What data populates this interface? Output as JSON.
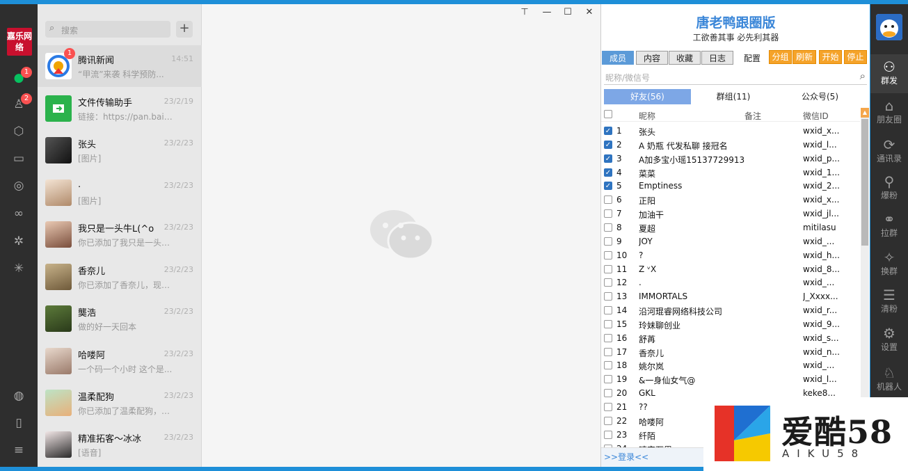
{
  "rail": {
    "logo_text": "嘉乐网络",
    "chat_badge": "1",
    "contacts_badge": "2"
  },
  "chat_list": {
    "search_placeholder": "搜索",
    "add_label": "+",
    "items": [
      {
        "name": "腾讯新闻",
        "time": "14:51",
        "preview": "“甲流”来袭 科学预防...",
        "badge": "1"
      },
      {
        "name": "文件传输助手",
        "time": "23/2/19",
        "preview": "链接：https://pan.baid..."
      },
      {
        "name": "张头",
        "time": "23/2/23",
        "preview": "[图片]"
      },
      {
        "name": ".",
        "time": "23/2/23",
        "preview": "[图片]"
      },
      {
        "name": "我只是一头牛ᒪ(^o",
        "time": "23/2/23",
        "preview": "你已添加了我只是一头牛..."
      },
      {
        "name": "香奈儿",
        "time": "23/2/23",
        "preview": "你已添加了香奈儿，现在..."
      },
      {
        "name": "龑浩",
        "time": "23/2/23",
        "preview": "做的好一天回本"
      },
      {
        "name": "哈喽阿",
        "time": "23/2/23",
        "preview": "一个码一个小时 这个是..."
      },
      {
        "name": "温柔配狗",
        "time": "23/2/23",
        "preview": "你已添加了温柔配狗，现..."
      },
      {
        "name": "精准拓客～冰冰",
        "time": "23/2/23",
        "preview": "[语音]"
      }
    ]
  },
  "window_controls": {
    "pin": "⊤",
    "minimize": "—",
    "maximize": "☐",
    "close": "✕"
  },
  "plugin": {
    "title": "唐老鸭跟圈版",
    "subtitle": "工欲善其事 必先利其器",
    "tabs": [
      "成员",
      "内容",
      "收藏",
      "日志",
      "配置"
    ],
    "buttons": [
      "分组",
      "刷新",
      "开始",
      "停止"
    ],
    "search_placeholder": "昵称/微信号",
    "subtabs": [
      "好友(56)",
      "群组(11)",
      "公众号(5)"
    ],
    "columns": {
      "nickname": "昵称",
      "remark": "备注",
      "wxid": "微信ID"
    },
    "rows": [
      {
        "no": "1",
        "nick": "张头",
        "wxid": "wxid_x...",
        "checked": true
      },
      {
        "no": "2",
        "nick": "A 奶瓶 代发私聊 接冠名",
        "wxid": "wxid_l...",
        "checked": true
      },
      {
        "no": "3",
        "nick": "A加多宝小瑶15137729913",
        "wxid": "wxid_p...",
        "checked": true
      },
      {
        "no": "4",
        "nick": "菜菜",
        "wxid": "wxid_1...",
        "checked": true
      },
      {
        "no": "5",
        "nick": "Emptiness",
        "wxid": "wxid_2...",
        "checked": true
      },
      {
        "no": "6",
        "nick": "正阳",
        "wxid": "wxid_x...",
        "checked": false
      },
      {
        "no": "7",
        "nick": "加油干",
        "wxid": "wxid_jl...",
        "checked": false
      },
      {
        "no": "8",
        "nick": "夏超",
        "wxid": "mitilasu",
        "checked": false
      },
      {
        "no": "9",
        "nick": "JOY",
        "wxid": "wxid_...",
        "checked": false
      },
      {
        "no": "10",
        "nick": "?",
        "wxid": "wxid_h...",
        "checked": false
      },
      {
        "no": "11",
        "nick": "Z ᵛX",
        "wxid": "wxid_8...",
        "checked": false
      },
      {
        "no": "12",
        "nick": ".",
        "wxid": "wxid_...",
        "checked": false
      },
      {
        "no": "13",
        "nick": "IMMORTALS",
        "wxid": "J_Xxxx...",
        "checked": false
      },
      {
        "no": "14",
        "nick": "沿河琨睿网络科技公司",
        "wxid": "wxid_r...",
        "checked": false
      },
      {
        "no": "15",
        "nick": "玲妹聊创业",
        "wxid": "wxid_9...",
        "checked": false
      },
      {
        "no": "16",
        "nick": "舒苒",
        "wxid": "wxid_s...",
        "checked": false
      },
      {
        "no": "17",
        "nick": "香奈儿",
        "wxid": "wxid_n...",
        "checked": false
      },
      {
        "no": "18",
        "nick": "姚尔岚",
        "wxid": "wxid_...",
        "checked": false
      },
      {
        "no": "19",
        "nick": "&一身仙女气@",
        "wxid": "wxid_l...",
        "checked": false
      },
      {
        "no": "20",
        "nick": "GKL",
        "wxid": "keke8...",
        "checked": false
      },
      {
        "no": "21",
        "nick": "??",
        "wxid": "",
        "checked": false
      },
      {
        "no": "22",
        "nick": "哈喽阿",
        "wxid": "",
        "checked": false
      },
      {
        "no": "23",
        "nick": "纤陌",
        "wxid": "",
        "checked": false
      },
      {
        "no": "24",
        "nick": "晴空万里",
        "wxid": "",
        "checked": false
      }
    ],
    "login_link": ">>登录<<"
  },
  "function_bar": {
    "items": [
      "群发",
      "朋友圈",
      "通讯录",
      "爆粉",
      "拉群",
      "换群",
      "清粉",
      "设置",
      "机器人"
    ]
  },
  "watermark": {
    "text": "爱酷58",
    "sub": "AIKU58"
  },
  "colors": {
    "accent_blue": "#3a86d8",
    "orange": "#f5a32a",
    "wechat_green": "#07c160",
    "badge_red": "#fa5151"
  }
}
